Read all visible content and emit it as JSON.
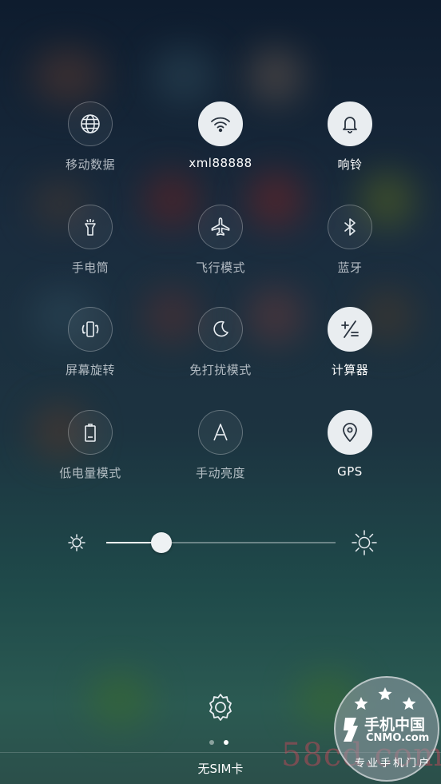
{
  "tiles": [
    {
      "label": "移动数据",
      "icon": "globe-icon",
      "on": false
    },
    {
      "label": "xml88888",
      "icon": "wifi-icon",
      "on": true
    },
    {
      "label": "响铃",
      "icon": "bell-icon",
      "on": true
    },
    {
      "label": "手电筒",
      "icon": "flashlight-icon",
      "on": false
    },
    {
      "label": "飞行模式",
      "icon": "airplane-icon",
      "on": false
    },
    {
      "label": "蓝牙",
      "icon": "bluetooth-icon",
      "on": false
    },
    {
      "label": "屏幕旋转",
      "icon": "rotate-screen-icon",
      "on": false
    },
    {
      "label": "免打扰模式",
      "icon": "moon-icon",
      "on": false
    },
    {
      "label": "计算器",
      "icon": "calculator-icon",
      "on": true
    },
    {
      "label": "低电量模式",
      "icon": "battery-icon",
      "on": false
    },
    {
      "label": "手动亮度",
      "icon": "auto-brightness-icon",
      "on": false
    },
    {
      "label": "GPS",
      "icon": "location-pin-icon",
      "on": true
    }
  ],
  "brightness": {
    "level": 0.24,
    "low_icon": "sun-small-icon",
    "high_icon": "sun-large-icon"
  },
  "footer": {
    "settings_icon": "gear-icon",
    "pages": 2,
    "current_page": 2,
    "sim_status": "无SIM卡"
  },
  "watermark": {
    "site": "58cd.com",
    "logo_title": "手机中国",
    "logo_domain": "CNMO.com",
    "logo_slogan": "专业手机门户"
  }
}
